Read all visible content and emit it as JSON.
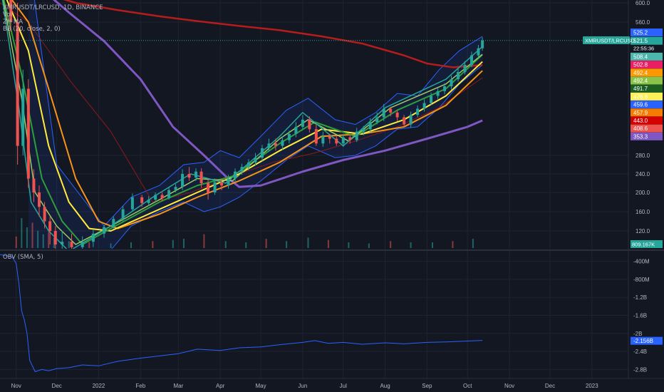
{
  "legend": {
    "symbol": "XMRUSDT/LRCUSD, 1D, BINANCE",
    "vol": "Vol",
    "zh_ma": "ZH MA",
    "bb": "BB (20, close, 2, 0)",
    "obv": "OBV (SMA, 5)"
  },
  "price_tag_label": "XMRUSDT/LRCUSD",
  "colors": {
    "background": "#131722",
    "grid": "#1f2330",
    "up_candle": "#26a69a",
    "down_candle": "#ef5350",
    "bb_line": "#2962ff",
    "bb_fill": "rgba(41,98,255,0.10)",
    "obv_line": "#2962ff",
    "purple_ma": "#7e57c2",
    "dark_red_ma": "#b71c1c",
    "thin_red_ma": "#8b1a1a"
  },
  "chart_data": [
    {
      "type": "line",
      "panel": "price",
      "ylim": [
        100,
        600
      ],
      "price_axis_ticks": [
        "600.0",
        "560.0",
        "280.0",
        "240.0",
        "200.0",
        "160.0",
        "120.0"
      ],
      "price_axis_tick_values": [
        600,
        560,
        280,
        240,
        200,
        160,
        120
      ],
      "x_axis_labels": [
        "Nov",
        "Dec",
        "2022",
        "Feb",
        "Mar",
        "Apr",
        "May",
        "Jun",
        "Jul",
        "Aug",
        "Sep",
        "Oct",
        "Nov",
        "Dec",
        "2023"
      ],
      "x_axis_months": [
        "2021-11",
        "2021-12",
        "2022-01",
        "2022-02",
        "2022-03",
        "2022-04",
        "2022-05",
        "2022-06",
        "2022-07",
        "2022-08",
        "2022-09",
        "2022-10",
        "2022-11",
        "2022-12",
        "2023-01"
      ],
      "last_price": 521.5,
      "countdown": "22:55:36",
      "price_labels": [
        {
          "text": "525.2",
          "value": 525.2,
          "color": "#2962ff"
        },
        {
          "text": "521.5",
          "value": 521.5,
          "color": "#26a69a"
        },
        {
          "text": "508.4",
          "value": 508.4,
          "color": "#4db6ac"
        },
        {
          "text": "502.8",
          "value": 502.8,
          "color": "#e91e63"
        },
        {
          "text": "492.4",
          "value": 492.4,
          "color": "#ff9800"
        },
        {
          "text": "492.4",
          "value": 492.4,
          "color": "#8bc34a"
        },
        {
          "text": "491.7",
          "value": 491.7,
          "color": "#1b5e20"
        },
        {
          "text": "476.8",
          "value": 476.8,
          "color": "#ffee58"
        },
        {
          "text": "459.6",
          "value": 459.6,
          "color": "#2962ff"
        },
        {
          "text": "457.9",
          "value": 457.9,
          "color": "#f57c00"
        },
        {
          "text": "443.0",
          "value": 443.0,
          "color": "#d50000"
        },
        {
          "text": "408.6",
          "value": 408.6,
          "color": "#ef5350"
        },
        {
          "text": "353.3",
          "value": 353.3,
          "color": "#7e57c2"
        }
      ],
      "volume_label": "809.167K",
      "series": [
        {
          "key": "purple",
          "x": [
            "2021-10-20",
            "2021-11-15",
            "2021-12-10",
            "2022-01-05",
            "2022-02-01",
            "2022-02-25",
            "2022-03-20",
            "2022-04-05",
            "2022-04-15",
            "2022-05-01",
            "2022-06-01",
            "2022-07-01",
            "2022-08-01",
            "2022-09-01",
            "2022-10-01",
            "2022-10-12"
          ],
          "y": [
            700,
            640,
            580,
            520,
            440,
            340,
            280,
            235,
            212,
            215,
            245,
            270,
            290,
            315,
            340,
            353.3
          ]
        },
        {
          "key": "dark_red",
          "x": [
            "2021-10-20",
            "2021-11-15",
            "2021-12-15",
            "2022-01-15",
            "2022-02-15",
            "2022-03-15",
            "2022-04-15",
            "2022-05-15",
            "2022-06-15",
            "2022-07-15",
            "2022-08-15",
            "2022-09-01",
            "2022-09-20",
            "2022-10-12"
          ],
          "y": [
            660,
            625,
            600,
            585,
            572,
            562,
            552,
            543,
            530,
            515,
            490,
            473,
            465,
            470
          ]
        },
        {
          "key": "thin_red",
          "x": [
            "2021-10-20",
            "2021-11-10",
            "2021-12-10",
            "2022-01-10",
            "2022-02-10",
            "2022-03-10",
            "2022-04-10",
            "2022-05-10",
            "2022-06-10",
            "2022-07-10",
            "2022-08-10",
            "2022-09-10",
            "2022-10-12"
          ],
          "y": [
            600,
            560,
            440,
            330,
            180,
            200,
            235,
            265,
            285,
            310,
            340,
            380,
            443
          ]
        },
        {
          "key": "orange",
          "x": [
            "2021-10-20",
            "2021-11-10",
            "2021-11-25",
            "2021-12-15",
            "2022-01-01",
            "2022-01-15",
            "2022-02-15",
            "2022-03-15",
            "2022-04-15",
            "2022-05-15",
            "2022-06-15",
            "2022-07-15",
            "2022-08-15",
            "2022-09-15",
            "2022-10-12"
          ],
          "y": [
            640,
            560,
            420,
            230,
            140,
            125,
            155,
            190,
            225,
            265,
            320,
            325,
            340,
            385,
            457.9
          ]
        },
        {
          "key": "yellow",
          "x": [
            "2021-10-20",
            "2021-11-10",
            "2021-11-25",
            "2021-12-10",
            "2021-12-25",
            "2022-01-10",
            "2022-02-15",
            "2022-03-15",
            "2022-04-15",
            "2022-05-15",
            "2022-06-15",
            "2022-07-15",
            "2022-08-15",
            "2022-09-15",
            "2022-10-12"
          ],
          "y": [
            640,
            500,
            300,
            180,
            125,
            120,
            165,
            200,
            240,
            290,
            335,
            325,
            355,
            405,
            476.8
          ]
        },
        {
          "key": "green_dark",
          "x": [
            "2021-10-20",
            "2021-11-05",
            "2021-11-20",
            "2021-12-05",
            "2021-12-20",
            "2022-01-10",
            "2022-02-15",
            "2022-03-15",
            "2022-04-10",
            "2022-05-15",
            "2022-06-10",
            "2022-07-10",
            "2022-08-10",
            "2022-09-15",
            "2022-10-12"
          ],
          "y": [
            640,
            450,
            230,
            140,
            110,
            125,
            180,
            215,
            235,
            305,
            350,
            320,
            375,
            420,
            491.7
          ]
        },
        {
          "key": "green_light",
          "x": [
            "2021-10-20",
            "2021-11-05",
            "2021-11-15",
            "2021-12-01",
            "2021-12-15",
            "2022-01-10",
            "2022-02-15",
            "2022-03-15",
            "2022-04-10",
            "2022-05-15",
            "2022-06-05",
            "2022-07-05",
            "2022-08-05",
            "2022-09-15",
            "2022-10-12"
          ],
          "y": [
            640,
            400,
            200,
            130,
            110,
            130,
            185,
            230,
            225,
            315,
            355,
            310,
            380,
            430,
            492.4
          ]
        },
        {
          "key": "teal",
          "x": [
            "2021-10-20",
            "2021-11-03",
            "2021-11-12",
            "2021-11-25",
            "2021-12-10",
            "2022-01-10",
            "2022-02-10",
            "2022-03-10",
            "2022-04-05",
            "2022-05-15",
            "2022-06-01",
            "2022-07-01",
            "2022-08-01",
            "2022-09-15",
            "2022-10-12"
          ],
          "y": [
            640,
            380,
            180,
            120,
            105,
            130,
            190,
            240,
            220,
            320,
            370,
            300,
            380,
            440,
            508.4
          ]
        }
      ],
      "bollinger": {
        "x": [
          "2021-11-10",
          "2021-12-01",
          "2022-01-05",
          "2022-01-25",
          "2022-02-15",
          "2022-03-05",
          "2022-03-20",
          "2022-04-01",
          "2022-04-15",
          "2022-05-01",
          "2022-05-20",
          "2022-06-05",
          "2022-06-25",
          "2022-07-10",
          "2022-07-25",
          "2022-08-10",
          "2022-08-25",
          "2022-09-10",
          "2022-09-25",
          "2022-10-12"
        ],
        "upper": [
          700,
          260,
          130,
          190,
          215,
          260,
          265,
          290,
          275,
          320,
          375,
          400,
          355,
          345,
          370,
          410,
          405,
          460,
          500,
          530
        ],
        "lower": [
          100,
          100,
          100,
          130,
          160,
          180,
          160,
          170,
          190,
          225,
          270,
          300,
          275,
          280,
          300,
          335,
          340,
          380,
          430,
          470
        ]
      },
      "candles": {
        "x": [
          "2021-10-28",
          "2021-11-02",
          "2021-11-06",
          "2021-11-10",
          "2021-11-14",
          "2021-11-18",
          "2021-11-22",
          "2021-11-26",
          "2021-11-30",
          "2021-12-05",
          "2021-12-12",
          "2021-12-20",
          "2021-12-28",
          "2022-01-05",
          "2022-01-12",
          "2022-01-19",
          "2022-01-26",
          "2022-02-02",
          "2022-02-07",
          "2022-02-12",
          "2022-02-17",
          "2022-02-22",
          "2022-02-27",
          "2022-03-04",
          "2022-03-09",
          "2022-03-14",
          "2022-03-18",
          "2022-03-23",
          "2022-03-28",
          "2022-04-02",
          "2022-04-07",
          "2022-04-12",
          "2022-04-17",
          "2022-04-22",
          "2022-04-27",
          "2022-05-02",
          "2022-05-07",
          "2022-05-12",
          "2022-05-17",
          "2022-05-22",
          "2022-05-27",
          "2022-06-01",
          "2022-06-06",
          "2022-06-11",
          "2022-06-16",
          "2022-06-21",
          "2022-06-26",
          "2022-07-01",
          "2022-07-06",
          "2022-07-11",
          "2022-07-16",
          "2022-07-21",
          "2022-07-26",
          "2022-07-31",
          "2022-08-05",
          "2022-08-10",
          "2022-08-15",
          "2022-08-20",
          "2022-08-25",
          "2022-08-30",
          "2022-09-04",
          "2022-09-09",
          "2022-09-14",
          "2022-09-19",
          "2022-09-24",
          "2022-09-29",
          "2022-10-04",
          "2022-10-09",
          "2022-10-12"
        ],
        "open": [
          640,
          560,
          300,
          420,
          230,
          200,
          170,
          140,
          120,
          110,
          112,
          108,
          112,
          118,
          128,
          145,
          165,
          190,
          178,
          185,
          195,
          188,
          205,
          212,
          240,
          232,
          245,
          220,
          200,
          222,
          215,
          230,
          245,
          255,
          265,
          275,
          295,
          305,
          300,
          312,
          325,
          340,
          355,
          335,
          305,
          320,
          315,
          305,
          318,
          312,
          330,
          335,
          350,
          360,
          378,
          370,
          360,
          345,
          365,
          378,
          390,
          405,
          415,
          425,
          440,
          455,
          470,
          490,
          505
        ],
        "close": [
          560,
          300,
          420,
          230,
          200,
          170,
          140,
          120,
          110,
          112,
          108,
          112,
          118,
          128,
          145,
          165,
          190,
          178,
          185,
          195,
          188,
          205,
          212,
          240,
          232,
          245,
          220,
          200,
          222,
          215,
          230,
          245,
          255,
          265,
          275,
          295,
          305,
          300,
          312,
          325,
          340,
          355,
          335,
          305,
          320,
          315,
          305,
          318,
          312,
          330,
          335,
          350,
          360,
          378,
          370,
          360,
          345,
          365,
          378,
          390,
          405,
          415,
          425,
          440,
          455,
          470,
          490,
          505,
          521.5
        ],
        "high": [
          700,
          600,
          460,
          440,
          250,
          215,
          180,
          150,
          130,
          120,
          118,
          116,
          122,
          132,
          150,
          172,
          198,
          195,
          192,
          200,
          200,
          212,
          218,
          250,
          255,
          252,
          252,
          228,
          230,
          228,
          238,
          252,
          262,
          272,
          285,
          302,
          315,
          315,
          320,
          332,
          350,
          365,
          362,
          345,
          330,
          325,
          322,
          325,
          325,
          338,
          342,
          358,
          370,
          388,
          382,
          375,
          365,
          372,
          385,
          398,
          412,
          422,
          432,
          448,
          462,
          478,
          498,
          512,
          528
        ],
        "low": [
          540,
          260,
          280,
          210,
          180,
          150,
          125,
          110,
          100,
          102,
          100,
          104,
          108,
          115,
          125,
          140,
          160,
          170,
          172,
          180,
          182,
          185,
          200,
          205,
          225,
          225,
          210,
          185,
          195,
          205,
          208,
          222,
          238,
          248,
          258,
          268,
          288,
          290,
          292,
          305,
          318,
          335,
          328,
          300,
          298,
          305,
          300,
          298,
          305,
          308,
          322,
          328,
          345,
          352,
          362,
          352,
          340,
          338,
          360,
          372,
          385,
          398,
          408,
          418,
          435,
          450,
          465,
          485,
          500
        ]
      },
      "volume": {
        "x": [
          "2021-11-01",
          "2021-11-05",
          "2021-11-09",
          "2021-11-13",
          "2021-11-17",
          "2021-11-21",
          "2021-11-25",
          "2021-11-29",
          "2021-12-10",
          "2021-12-25",
          "2022-01-10",
          "2022-01-25",
          "2022-02-10",
          "2022-02-25",
          "2022-03-05",
          "2022-03-20",
          "2022-04-05",
          "2022-04-20",
          "2022-05-05",
          "2022-05-20",
          "2022-06-05",
          "2022-06-20",
          "2022-07-05",
          "2022-07-20",
          "2022-08-05",
          "2022-08-20",
          "2022-09-05",
          "2022-09-20",
          "2022-10-05"
        ],
        "values": [
          1.0,
          2.6,
          1.8,
          2.2,
          1.5,
          1.2,
          1.4,
          0.9,
          0.6,
          0.5,
          0.4,
          0.5,
          0.6,
          0.7,
          0.8,
          1.2,
          0.6,
          0.5,
          0.8,
          0.6,
          0.9,
          0.7,
          0.5,
          0.4,
          0.6,
          0.5,
          0.5,
          0.6,
          0.8
        ]
      }
    },
    {
      "type": "line",
      "panel": "obv",
      "title": "OBV (SMA, 5)",
      "ylim": [
        -3.0,
        -0.2
      ],
      "axis_ticks": [
        "-400M",
        "-800M",
        "-1.2B",
        "-1.6B",
        "-2B",
        "-2.4B",
        "-2.8B"
      ],
      "axis_tick_values": [
        -0.4,
        -0.8,
        -1.2,
        -1.6,
        -2.0,
        -2.4,
        -2.8
      ],
      "last_value_label": "-2.156B",
      "last_value": -2.156,
      "series": [
        {
          "name": "OBV",
          "unit": "B",
          "x": [
            "2021-10-20",
            "2021-10-25",
            "2021-10-29",
            "2021-11-01",
            "2021-11-03",
            "2021-11-05",
            "2021-11-07",
            "2021-11-09",
            "2021-11-11",
            "2021-11-15",
            "2021-11-20",
            "2021-11-25",
            "2021-12-01",
            "2021-12-10",
            "2021-12-20",
            "2022-01-01",
            "2022-01-15",
            "2022-02-01",
            "2022-02-15",
            "2022-03-01",
            "2022-03-15",
            "2022-04-01",
            "2022-04-15",
            "2022-05-01",
            "2022-05-15",
            "2022-06-01",
            "2022-06-10",
            "2022-06-20",
            "2022-07-01",
            "2022-07-15",
            "2022-08-01",
            "2022-08-15",
            "2022-09-01",
            "2022-09-15",
            "2022-10-01",
            "2022-10-12"
          ],
          "y": [
            -0.25,
            -0.28,
            -0.3,
            -0.45,
            -0.9,
            -1.5,
            -1.7,
            -2.0,
            -2.6,
            -2.85,
            -2.8,
            -2.83,
            -2.78,
            -2.76,
            -2.7,
            -2.72,
            -2.62,
            -2.55,
            -2.5,
            -2.45,
            -2.35,
            -2.38,
            -2.32,
            -2.3,
            -2.25,
            -2.2,
            -2.16,
            -2.22,
            -2.2,
            -2.24,
            -2.21,
            -2.23,
            -2.2,
            -2.19,
            -2.17,
            -2.156
          ]
        }
      ]
    }
  ]
}
